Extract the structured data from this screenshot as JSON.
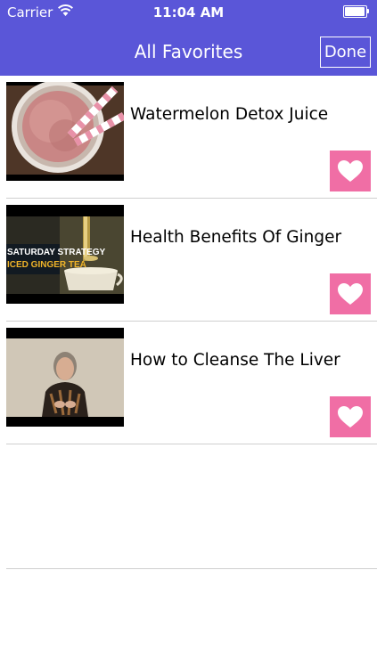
{
  "status_bar": {
    "carrier": "Carrier",
    "time": "11:04 AM",
    "wifi_icon": "wifi-icon",
    "battery_icon": "battery-icon"
  },
  "nav": {
    "title": "All Favorites",
    "done_label": "Done"
  },
  "colors": {
    "nav_bar": "#5a56d8",
    "favorite_button": "#f06ea5",
    "separator": "#cfcfcf"
  },
  "favorites": [
    {
      "title": "Watermelon Detox Juice",
      "thumbnail": "smoothie-glass-thumbnail",
      "favorite_icon": "heart-icon"
    },
    {
      "title": "Health Benefits Of Ginger",
      "thumbnail": "ginger-tea-thumbnail",
      "thumbnail_text": [
        "SATURDAY STRATEGY",
        "ICED GINGER TEA"
      ],
      "favorite_icon": "heart-icon"
    },
    {
      "title": "How to Cleanse The Liver",
      "thumbnail": "speaker-video-thumbnail",
      "favorite_icon": "heart-icon"
    }
  ]
}
